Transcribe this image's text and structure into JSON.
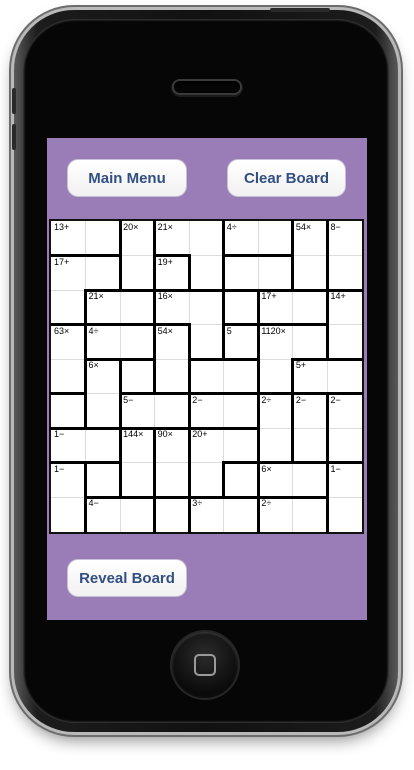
{
  "buttons": {
    "main_menu": "Main Menu",
    "clear_board": "Clear Board",
    "reveal_board": "Reveal Board"
  },
  "colors": {
    "screen_background": "#9a7cb7",
    "button_text": "#324f83",
    "cage_wall": "#000000"
  },
  "board": {
    "size": 9,
    "cages": [
      {
        "clue": "13+",
        "cells": [
          [
            0,
            0
          ],
          [
            0,
            1
          ]
        ]
      },
      {
        "clue": "20×",
        "cells": [
          [
            0,
            2
          ],
          [
            1,
            2
          ],
          [
            2,
            1
          ]
        ]
      },
      {
        "clue": "21×",
        "cells": [
          [
            0,
            3
          ],
          [
            0,
            4
          ],
          [
            1,
            4
          ]
        ]
      },
      {
        "clue": "4÷",
        "cells": [
          [
            0,
            5
          ],
          [
            0,
            6
          ]
        ]
      },
      {
        "clue": "54×",
        "cells": [
          [
            0,
            7
          ],
          [
            1,
            7
          ]
        ]
      },
      {
        "clue": "8−",
        "cells": [
          [
            0,
            8
          ],
          [
            1,
            8
          ]
        ]
      },
      {
        "clue": "17+",
        "cells": [
          [
            1,
            0
          ],
          [
            1,
            1
          ],
          [
            2,
            0
          ]
        ]
      },
      {
        "clue": "19+",
        "cells": [
          [
            1,
            3
          ],
          [
            1,
            5
          ],
          [
            1,
            6
          ]
        ]
      },
      {
        "clue": "21×",
        "cells": [
          [
            2,
            1
          ],
          [
            2,
            2
          ]
        ]
      },
      {
        "clue": "16×",
        "cells": [
          [
            2,
            3
          ],
          [
            2,
            4
          ],
          [
            3,
            4
          ]
        ]
      },
      {
        "clue": "17+",
        "cells": [
          [
            2,
            6
          ],
          [
            2,
            7
          ]
        ]
      },
      {
        "clue": "14+",
        "cells": [
          [
            2,
            8
          ],
          [
            3,
            8
          ]
        ]
      },
      {
        "clue": "63×",
        "cells": [
          [
            3,
            0
          ],
          [
            4,
            0
          ]
        ]
      },
      {
        "clue": "4÷",
        "cells": [
          [
            3,
            1
          ],
          [
            3,
            2
          ]
        ]
      },
      {
        "clue": "54×",
        "cells": [
          [
            3,
            3
          ],
          [
            4,
            3
          ]
        ]
      },
      {
        "clue": "5",
        "cells": [
          [
            3,
            5
          ]
        ]
      },
      {
        "clue": "1120×",
        "cells": [
          [
            3,
            6
          ],
          [
            3,
            7
          ],
          [
            4,
            6
          ]
        ]
      },
      {
        "clue": "6×",
        "cells": [
          [
            4,
            1
          ],
          [
            5,
            1
          ]
        ]
      },
      {
        "clue": "5+",
        "cells": [
          [
            4,
            7
          ],
          [
            4,
            8
          ]
        ]
      },
      {
        "clue": "5−",
        "cells": [
          [
            5,
            2
          ],
          [
            5,
            3
          ]
        ]
      },
      {
        "clue": "2−",
        "cells": [
          [
            5,
            4
          ],
          [
            5,
            5
          ]
        ]
      },
      {
        "clue": "2÷",
        "cells": [
          [
            5,
            6
          ],
          [
            6,
            6
          ]
        ]
      },
      {
        "clue": "2−",
        "cells": [
          [
            5,
            7
          ],
          [
            6,
            7
          ]
        ]
      },
      {
        "clue": "2−",
        "cells": [
          [
            5,
            8
          ],
          [
            6,
            8
          ]
        ]
      },
      {
        "clue": "1−",
        "cells": [
          [
            6,
            0
          ],
          [
            6,
            1
          ]
        ]
      },
      {
        "clue": "144×",
        "cells": [
          [
            6,
            2
          ],
          [
            7,
            2
          ]
        ]
      },
      {
        "clue": "90×",
        "cells": [
          [
            6,
            3
          ],
          [
            7,
            3
          ]
        ]
      },
      {
        "clue": "20+",
        "cells": [
          [
            6,
            4
          ],
          [
            6,
            5
          ],
          [
            7,
            4
          ]
        ]
      },
      {
        "clue": "1−",
        "cells": [
          [
            7,
            0
          ],
          [
            8,
            0
          ]
        ]
      },
      {
        "clue": "6×",
        "cells": [
          [
            7,
            6
          ],
          [
            7,
            7
          ]
        ]
      },
      {
        "clue": "1−",
        "cells": [
          [
            7,
            8
          ],
          [
            8,
            8
          ]
        ]
      },
      {
        "clue": "4−",
        "cells": [
          [
            8,
            1
          ],
          [
            8,
            2
          ]
        ]
      },
      {
        "clue": "3÷",
        "cells": [
          [
            8,
            4
          ],
          [
            8,
            5
          ]
        ]
      },
      {
        "clue": "2÷",
        "cells": [
          [
            8,
            6
          ],
          [
            8,
            7
          ]
        ]
      }
    ]
  }
}
